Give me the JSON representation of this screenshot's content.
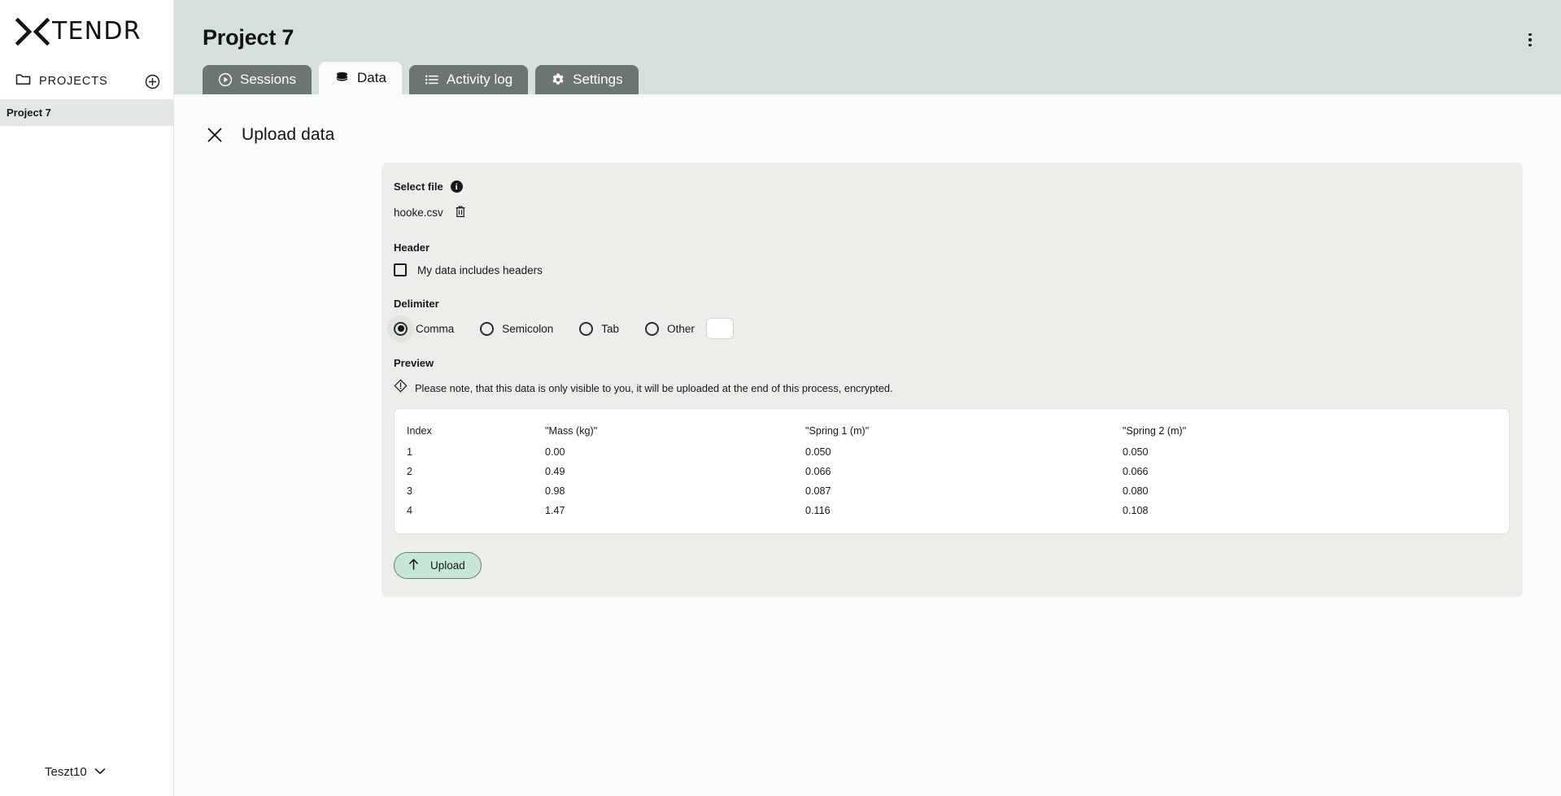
{
  "sidebar": {
    "logo_text": "TENDR",
    "logo_icon": "x-chevron-logo-icon",
    "projects_label": "PROJECTS",
    "folder_icon": "folder-icon",
    "add_icon": "plus-circle-icon",
    "projects": [
      {
        "label": "Project 7",
        "selected": true
      }
    ],
    "user": {
      "name": "Teszt10",
      "chevron_icon": "chevron-down-icon"
    }
  },
  "header": {
    "title": "Project 7",
    "menu_icon": "kebab-menu-icon",
    "background": "#d6dfdb",
    "tabs": [
      {
        "label": "Sessions",
        "icon": "play-circle-icon",
        "active": false
      },
      {
        "label": "Data",
        "icon": "database-icon",
        "active": true
      },
      {
        "label": "Activity log",
        "icon": "list-icon",
        "active": false
      },
      {
        "label": "Settings",
        "icon": "gear-icon",
        "active": false
      }
    ]
  },
  "upload": {
    "close_icon": "close-icon",
    "title": "Upload data",
    "select_file": {
      "label": "Select file",
      "info_icon": "info-icon",
      "info_glyph": "i",
      "file_name": "hooke.csv",
      "delete_icon": "trash-icon"
    },
    "header_section": {
      "label": "Header",
      "checkbox_label": "My data includes headers",
      "checked": false
    },
    "delimiter_section": {
      "label": "Delimiter",
      "options": [
        {
          "label": "Comma",
          "selected": true
        },
        {
          "label": "Semicolon",
          "selected": false
        },
        {
          "label": "Tab",
          "selected": false
        },
        {
          "label": "Other",
          "selected": false
        }
      ],
      "other_value": "",
      "other_placeholder": ""
    },
    "preview_section": {
      "label": "Preview",
      "note_icon": "warning-diamond-icon",
      "note": "Please note, that this data is only visible to you, it will be uploaded at the end of this process, encrypted.",
      "columns": [
        "Index",
        "\"Mass (kg)\"",
        "\"Spring 1 (m)\"",
        "\"Spring 2 (m)\""
      ],
      "rows": [
        [
          "1",
          "0.00",
          "0.050",
          "0.050"
        ],
        [
          "2",
          "0.49",
          "0.066",
          "0.066"
        ],
        [
          "3",
          "0.98",
          "0.087",
          "0.080"
        ],
        [
          "4",
          "1.47",
          "0.116",
          "0.108"
        ]
      ]
    },
    "upload_button": {
      "label": "Upload",
      "icon": "arrow-up-icon",
      "color": "#c6e7d6"
    }
  }
}
